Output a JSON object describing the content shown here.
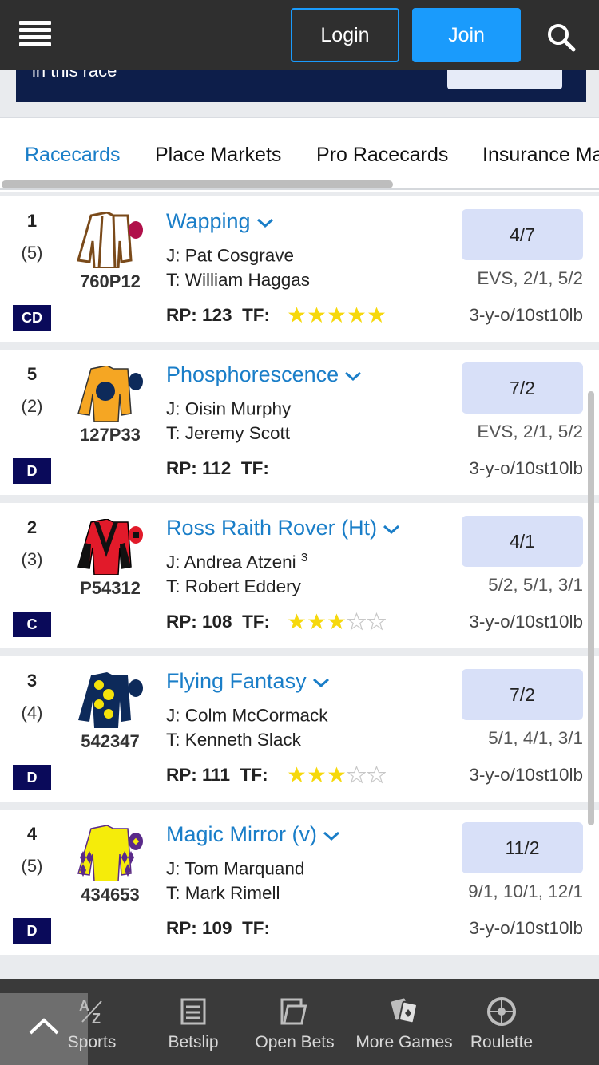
{
  "header": {
    "login_label": "Login",
    "join_label": "Join",
    "accent": "#1a9bfc"
  },
  "banner": {
    "text": "in this race"
  },
  "tabs": [
    {
      "label": "Racecards",
      "active": true
    },
    {
      "label": "Place Markets"
    },
    {
      "label": "Pro Racecards"
    },
    {
      "label": "Insurance Ma"
    }
  ],
  "runners": [
    {
      "number": "1",
      "draw": "(5)",
      "badge": "CD",
      "form": "760P12",
      "name": "Wapping",
      "jockey": "J: Pat Cosgrave",
      "jockey_claim": "",
      "trainer": "T: William Haggas",
      "rp": "RP: 123",
      "tf": "TF:",
      "tf_stars": 5,
      "tf_stars_shown": true,
      "odds": "4/7",
      "prev_odds": "EVS, 2/1, 5/2",
      "weight": "3-y-o/10st10lb",
      "silks": "white-brown"
    },
    {
      "number": "5",
      "draw": "(2)",
      "badge": "D",
      "form": "127P33",
      "name": "Phosphorescence",
      "jockey": "J: Oisin Murphy",
      "jockey_claim": "",
      "trainer": "T: Jeremy Scott",
      "rp": "RP: 112",
      "tf": "TF:",
      "tf_stars": 0,
      "tf_stars_shown": false,
      "odds": "7/2",
      "prev_odds": "EVS, 2/1, 5/2",
      "weight": "3-y-o/10st10lb",
      "silks": "orange-navy"
    },
    {
      "number": "2",
      "draw": "(3)",
      "badge": "C",
      "form": "P54312",
      "name": "Ross Raith Rover (Ht)",
      "jockey": "J: Andrea Atzeni",
      "jockey_claim": "3",
      "trainer": "T: Robert Eddery",
      "rp": "RP: 108",
      "tf": "TF:",
      "tf_stars": 3,
      "tf_stars_shown": true,
      "odds": "4/1",
      "prev_odds": "5/2, 5/1, 3/1",
      "weight": "3-y-o/10st10lb",
      "silks": "red-black"
    },
    {
      "number": "3",
      "draw": "(4)",
      "badge": "D",
      "form": "542347",
      "name": "Flying Fantasy",
      "jockey": "J: Colm McCormack",
      "jockey_claim": "",
      "trainer": "T: Kenneth Slack",
      "rp": "RP: 111",
      "tf": "TF:",
      "tf_stars": 3,
      "tf_stars_shown": true,
      "odds": "7/2",
      "prev_odds": "5/1, 4/1, 3/1",
      "weight": "3-y-o/10st10lb",
      "silks": "navy-yellow"
    },
    {
      "number": "4",
      "draw": "(5)",
      "badge": "D",
      "form": "434653",
      "name": "Magic Mirror (v)",
      "jockey": "J: Tom Marquand",
      "jockey_claim": "",
      "trainer": "T: Mark Rimell",
      "rp": "RP: 109",
      "tf": "TF:",
      "tf_stars": 0,
      "tf_stars_shown": false,
      "odds": "11/2",
      "prev_odds": "9/1, 10/1, 12/1",
      "weight": "3-y-o/10st10lb",
      "silks": "yellow-purple"
    }
  ],
  "bottom_nav": [
    {
      "label": "Sports",
      "icon": "az-icon"
    },
    {
      "label": "Betslip",
      "icon": "betslip-icon"
    },
    {
      "label": "Open Bets",
      "icon": "open-bets-icon"
    },
    {
      "label": "More Games",
      "icon": "cards-icon"
    },
    {
      "label": "Roulette",
      "icon": "roulette-icon"
    }
  ]
}
